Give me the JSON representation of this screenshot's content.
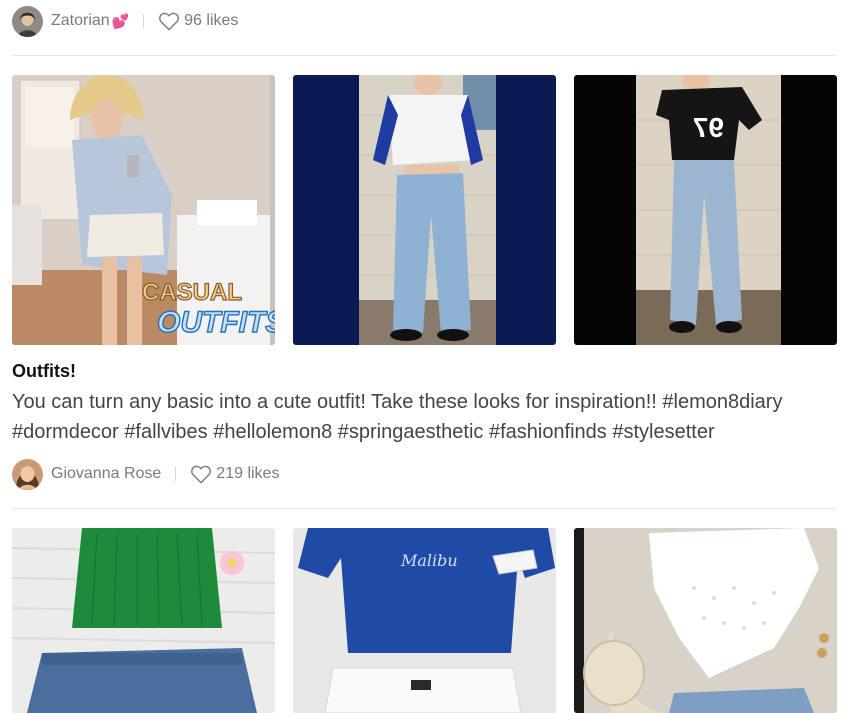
{
  "post1": {
    "author": "Zatorian",
    "author_emoji": "💕",
    "likes": "96 likes",
    "avatar_icon": "profile-avatar",
    "heart_icon": "heart-outline-icon",
    "images": [
      {
        "overlay_line1": "CASUAL",
        "overlay_line2": "OUTFITS!"
      },
      {},
      {}
    ],
    "title": "Outfits!",
    "body": "You can turn any basic into a cute outfit! Take these looks for inspiration!! #lemon8diary #dormdecor #fallvibes #hellolemon8 #springaesthetic #fashionfinds #stylesetter"
  },
  "post2": {
    "author": "Giovanna Rose",
    "likes": "219 likes",
    "images": [
      {},
      {
        "shirt_text": "Malibu"
      },
      {}
    ]
  },
  "colors": {
    "navy": "#0b1a52",
    "black": "#050505",
    "muted_text": "#7a7a7a",
    "divider": "#e6e6e6"
  }
}
